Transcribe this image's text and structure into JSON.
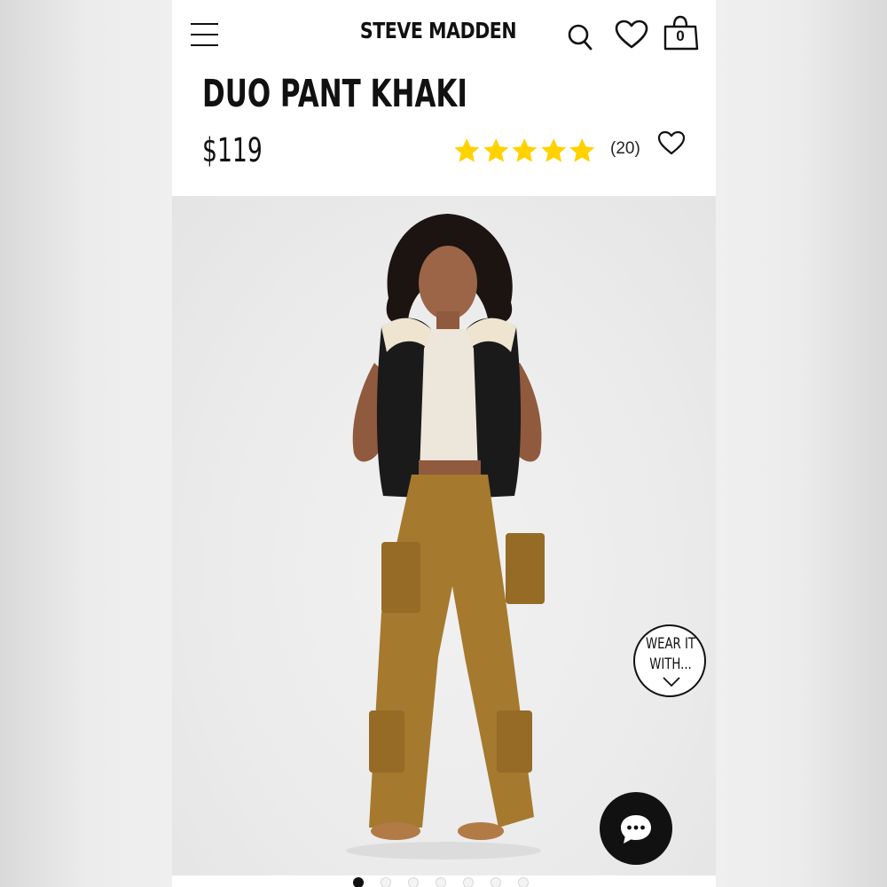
{
  "header": {
    "brand": "STEVE MADDEN",
    "menu_icon": "hamburger-menu-icon",
    "search_icon": "search-icon",
    "wishlist_icon": "heart-icon",
    "bag_icon": "shopping-bag-icon",
    "bag_count": "0"
  },
  "product": {
    "title": "DUO PANT KHAKI",
    "price": "$119",
    "rating": 5,
    "rating_max": 5,
    "review_count": "(20)",
    "star_color": "#FFD200",
    "favorite_icon": "heart-outline-icon"
  },
  "gallery": {
    "wear_it_line1": "WEAR IT",
    "wear_it_line2": "WITH...",
    "chat_icon": "chat-bubble-icon",
    "slide_count": 7,
    "active_slide": 1
  },
  "colors": {
    "text": "#111111",
    "background": "#ffffff",
    "pants_khaki": "#a5792e",
    "vest_black": "#1a1a1a"
  }
}
